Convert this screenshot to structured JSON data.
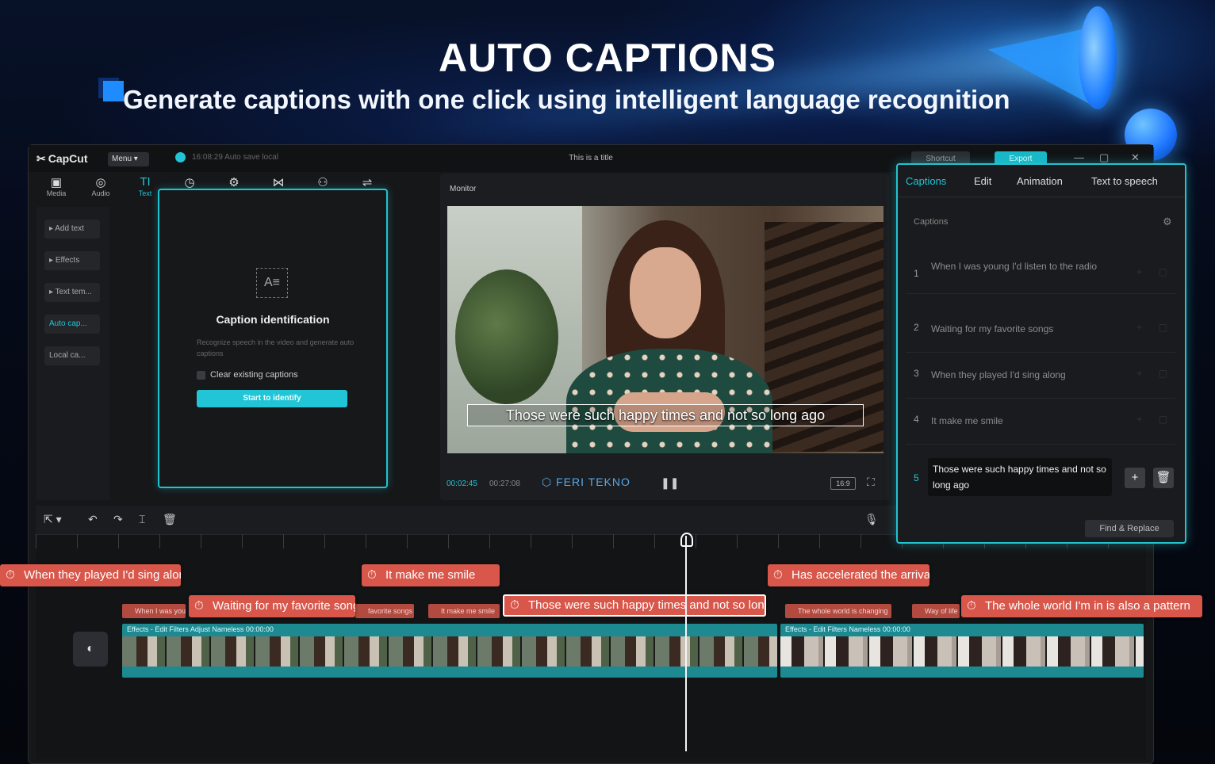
{
  "hero": {
    "title": "AUTO CAPTIONS",
    "subtitle": "Generate captions with one click using intelligent language recognition"
  },
  "app": {
    "logo": "CapCut",
    "menu_label": "Menu",
    "save_status": "16:08:29 Auto save local",
    "project_title": "This is a title",
    "shortcut_label": "Shortcut",
    "export_label": "Export"
  },
  "tools": [
    {
      "icon": "▣",
      "label": "Media"
    },
    {
      "icon": "◎",
      "label": "Audio"
    },
    {
      "icon": "TI",
      "label": "Text"
    },
    {
      "icon": "◷",
      "label": ""
    },
    {
      "icon": "⚙",
      "label": ""
    },
    {
      "icon": "⋈",
      "label": ""
    },
    {
      "icon": "⚇",
      "label": ""
    },
    {
      "icon": "⇌",
      "label": ""
    }
  ],
  "side_menu": [
    "Add text",
    "Effects",
    "Text tem...",
    "Auto cap...",
    "Local ca..."
  ],
  "popup": {
    "icon_text": "A≡",
    "title": "Caption identification",
    "description": "Recognize speech in the video and generate auto captions",
    "checkbox_label": "Clear existing captions",
    "button_label": "Start to identify"
  },
  "monitor": {
    "label": "Monitor",
    "caption": "Those were such happy times and not so long ago",
    "time_current": "00:02:45",
    "time_total": "00:27:08",
    "watermark": "FERI TEKNO",
    "ratio": "16:9"
  },
  "captions_panel": {
    "tabs": [
      "Captions",
      "Edit",
      "Animation",
      "Text to speech"
    ],
    "section_title": "Captions",
    "items": [
      {
        "num": "1",
        "text": "When I was young I'd listen to the radio"
      },
      {
        "num": "2",
        "text": "Waiting for my favorite songs"
      },
      {
        "num": "3",
        "text": "When they played I'd sing along"
      },
      {
        "num": "4",
        "text": "It make me smile"
      }
    ],
    "editing": {
      "num": "5",
      "text": "Those were such happy times and not so long ago"
    },
    "find_replace_label": "Find & Replace"
  },
  "timeline": {
    "clips": [
      {
        "text": "When they played I'd sing along"
      },
      {
        "text": "It make me smile"
      },
      {
        "text": "Has accelerated the arrival"
      },
      {
        "text": "Waiting for my favorite songs"
      },
      {
        "text": "Those were such happy times and not so long ago"
      },
      {
        "text": "The whole world I'm in is also a pattern"
      }
    ],
    "mini_clips": [
      "When I was young",
      "favorite songs",
      "It make me smile",
      "The whole world is changing",
      "Way of life"
    ],
    "track_label_a": "Effects - Edit   Filters   Adjust   Nameless   00:00:00",
    "track_label_b": "Effects - Edit   Filters   Nameless   00:00:00"
  },
  "colors": {
    "accent": "#21c5d6",
    "clip": "#d8564a"
  }
}
